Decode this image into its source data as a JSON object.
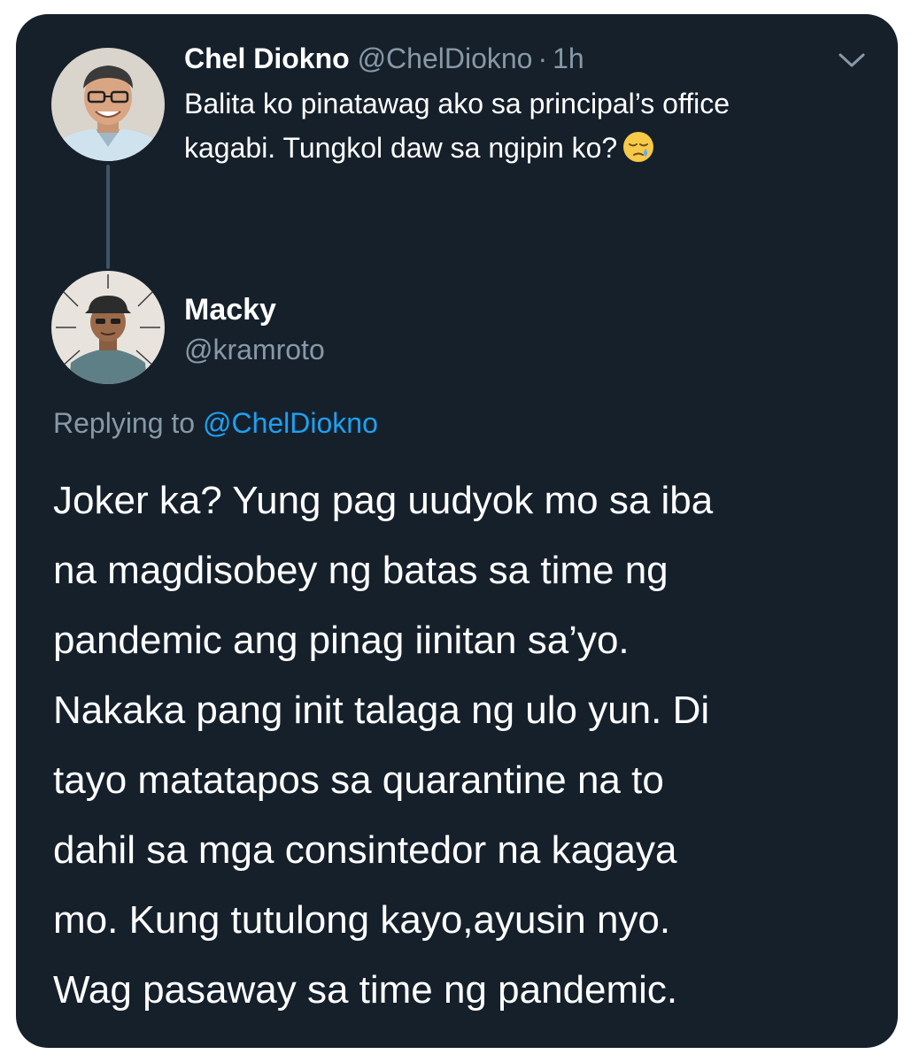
{
  "parent_tweet": {
    "author_name": "Chel Diokno",
    "author_handle": "@ChelDiokno",
    "separator": "·",
    "time": "1h",
    "text_lines": [
      "Balita ko pinatawag ako sa principal’s office",
      "kagabi. Tungkol daw sa ngipin ko?"
    ],
    "emoji_icon": "sleepy-face-emoji",
    "menu_icon": "chevron-down-icon"
  },
  "reply_tweet": {
    "author_name": "Macky",
    "author_handle": "@kramroto",
    "replying_label": "Replying to",
    "replying_to": "@ChelDiokno",
    "text_lines": [
      "Joker ka? Yung pag uudyok mo sa iba",
      "na magdisobey ng batas sa time ng",
      "pandemic ang pinag iinitan sa’yo.",
      "Nakaka pang init talaga ng ulo yun. Di",
      "tayo matatapos sa quarantine na to",
      "dahil sa mga consintedor na kagaya",
      "mo. Kung tutulong kayo,ayusin nyo.",
      "Wag pasaway sa time ng pandemic."
    ]
  },
  "colors": {
    "background": "#15202b",
    "primary_text": "#ffffff",
    "secondary_text": "#8899a6",
    "link": "#1da1f2",
    "thread_line": "#3d5466"
  }
}
